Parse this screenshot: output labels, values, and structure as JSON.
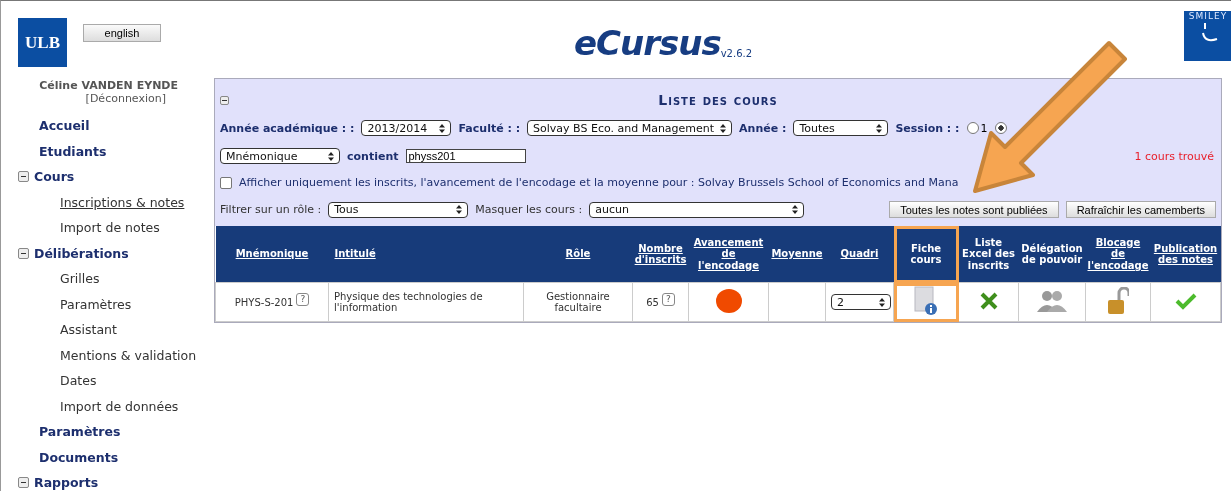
{
  "header": {
    "university_logo": "ULB",
    "language_button": "english",
    "app_name": "eCursus",
    "version": "v2.6.2",
    "partner_logo": "SMILEY"
  },
  "user": {
    "name": "Céline VANDEN EYNDE",
    "logout": "[Déconnexion]"
  },
  "sidebar": {
    "items": [
      {
        "label": "Accueil",
        "selected": false
      },
      {
        "label": "Etudiants",
        "selected": false
      },
      {
        "label": "Cours",
        "expanded": true,
        "selected": false,
        "children": [
          {
            "label": "Inscriptions & notes",
            "selected": true
          },
          {
            "label": "Import de notes",
            "selected": false
          }
        ]
      },
      {
        "label": "Délibérations",
        "expanded": true,
        "selected": false,
        "children": [
          {
            "label": "Grilles",
            "selected": false
          },
          {
            "label": "Paramètres",
            "selected": false
          },
          {
            "label": "Assistant",
            "selected": false
          },
          {
            "label": "Mentions & validation",
            "selected": false
          },
          {
            "label": "Dates",
            "selected": false
          },
          {
            "label": "Import de données",
            "selected": false
          }
        ]
      },
      {
        "label": "Paramètres",
        "selected": false
      },
      {
        "label": "Documents",
        "selected": false
      },
      {
        "label": "Rapports",
        "expanded": true,
        "selected": false
      }
    ]
  },
  "panel": {
    "title": "Liste des cours",
    "filters": {
      "year_label": "Année académique : :",
      "year": "2013/2014",
      "faculty_label": "Faculté : :",
      "faculty": "Solvay BS Eco. and Management",
      "level_label": "Année :",
      "level": "Toutes",
      "session_label": "Session : :",
      "sessions": [
        {
          "label": "1",
          "selected": false
        },
        {
          "selected": true
        }
      ],
      "field_select": "Mnémonique",
      "contains_label": "contient",
      "search_value": "physs201",
      "result_count": "1 cours trouvé",
      "only_enrolled": {
        "label": "Afficher uniquement les inscrits, l'avancement de l'encodage et la moyenne pour : Solvay Brussels School of Economics and Mana",
        "checked": false
      },
      "role_label": "Filtrer sur un rôle :",
      "role": "Tous",
      "hide_label": "Masquer les cours :",
      "hide": "aucun"
    },
    "buttons": [
      "Toutes les notes sont publiées",
      "Rafraîchir les camemberts"
    ]
  },
  "table": {
    "columns": [
      "Mnémonique",
      "Intitulé",
      "Rôle",
      "Nombre d'inscrits",
      "Avancement de l'encodage",
      "Moyenne",
      "Quadri",
      "Fiche cours",
      "Liste Excel des inscrits",
      "Délégation de pouvoir",
      "Blocage de l'encodage",
      "Publication des notes"
    ],
    "rows": [
      {
        "code": "PHYS-S-201",
        "code_help": "?",
        "title": "Physique des technologies de l'information",
        "role": "Gestionnaire facultaire",
        "enrolled": "65",
        "enrolled_help": "?",
        "color": "#f04a00",
        "quadri": "2",
        "locked": false,
        "published": true
      }
    ]
  }
}
